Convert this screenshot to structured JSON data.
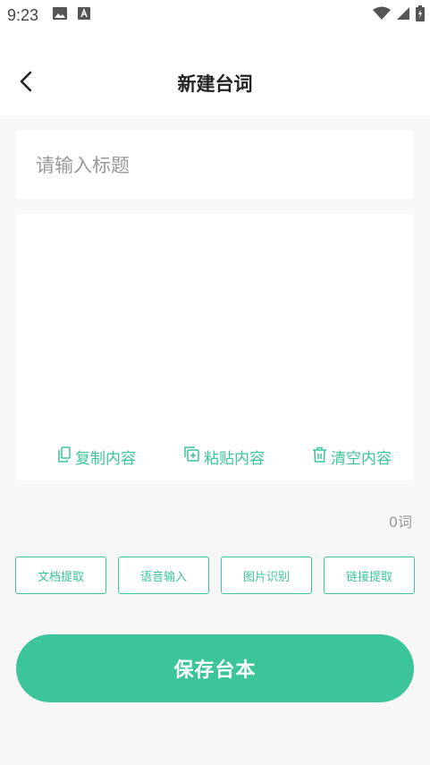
{
  "status_bar": {
    "time": "9:23",
    "icons_left": [
      "image-icon",
      "font-app-icon"
    ],
    "icons_right": [
      "wifi-icon",
      "signal-icon",
      "battery-charging-icon"
    ]
  },
  "nav": {
    "title": "新建台词",
    "back_icon": "chevron-left-icon"
  },
  "title_field": {
    "placeholder": "请输入标题",
    "value": ""
  },
  "content_field": {
    "value": ""
  },
  "content_actions": [
    {
      "label": "复制内容",
      "icon": "copy-icon"
    },
    {
      "label": "粘贴内容",
      "icon": "paste-icon"
    },
    {
      "label": "清空内容",
      "icon": "trash-icon"
    }
  ],
  "word_count": "0词",
  "tools": [
    {
      "label": "文档提取"
    },
    {
      "label": "语音输入"
    },
    {
      "label": "图片识别"
    },
    {
      "label": "链接提取"
    }
  ],
  "save_button": {
    "label": "保存台本"
  },
  "colors": {
    "accent": "#3cc59b",
    "background": "#f7f7f7",
    "card": "#ffffff",
    "placeholder": "#999999"
  }
}
